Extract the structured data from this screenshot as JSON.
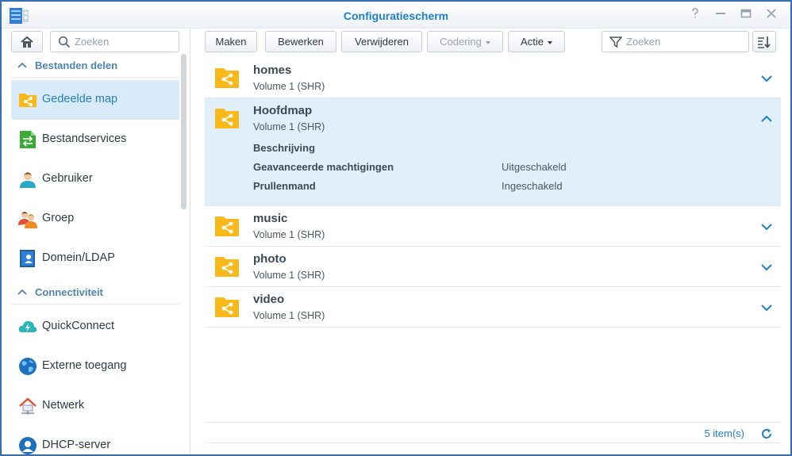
{
  "window": {
    "title": "Configuratiescherm",
    "controls": [
      "help-icon",
      "minimize-icon",
      "maximize-icon",
      "close-icon"
    ]
  },
  "sidebar": {
    "search_placeholder": "Zoeken",
    "sections": [
      {
        "label": "Bestanden delen",
        "items": [
          {
            "label": "Gedeelde map",
            "icon": "shared-folder-icon",
            "active": true
          },
          {
            "label": "Bestandservices",
            "icon": "file-services-icon"
          },
          {
            "label": "Gebruiker",
            "icon": "user-icon"
          },
          {
            "label": "Groep",
            "icon": "group-icon"
          },
          {
            "label": "Domein/LDAP",
            "icon": "domain-ldap-icon"
          }
        ]
      },
      {
        "label": "Connectiviteit",
        "items": [
          {
            "label": "QuickConnect",
            "icon": "quickconnect-icon"
          },
          {
            "label": "Externe toegang",
            "icon": "external-access-icon"
          },
          {
            "label": "Netwerk",
            "icon": "network-icon"
          },
          {
            "label": "DHCP-server",
            "icon": "dhcp-server-icon"
          }
        ]
      }
    ]
  },
  "toolbar": {
    "create": "Maken",
    "edit": "Bewerken",
    "delete": "Verwijderen",
    "encryption": "Codering",
    "action": "Actie",
    "search_placeholder": "Zoeken"
  },
  "folders": [
    {
      "name": "homes",
      "volume": "Volume 1 (SHR)"
    },
    {
      "name": "Hoofdmap",
      "volume": "Volume 1 (SHR)",
      "expanded": true,
      "details": [
        {
          "label": "Beschrijving",
          "value": ""
        },
        {
          "label": "Geavanceerde machtigingen",
          "value": "Uitgeschakeld"
        },
        {
          "label": "Prullenmand",
          "value": "Ingeschakeld"
        }
      ]
    },
    {
      "name": "music",
      "volume": "Volume 1 (SHR)"
    },
    {
      "name": "photo",
      "volume": "Volume 1 (SHR)"
    },
    {
      "name": "video",
      "volume": "Volume 1 (SHR)"
    }
  ],
  "footer": {
    "count": "5 item(s)"
  },
  "colors": {
    "accent": "#1f7fc7",
    "folder": "#f9b91a",
    "selected": "#d9ebf8"
  }
}
